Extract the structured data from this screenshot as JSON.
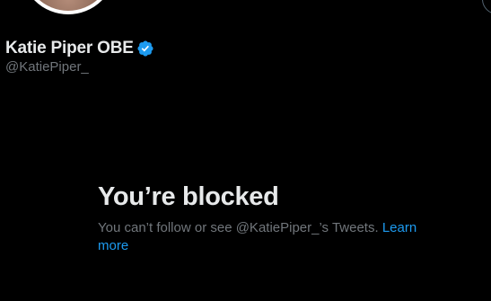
{
  "profile": {
    "name": "Katie Piper OBE",
    "handle": "@KatiePiper_",
    "verified": true,
    "verified_icon": "verified-badge-icon",
    "verified_color": "#1d9bf0"
  },
  "blocked": {
    "title": "You’re blocked",
    "message": "You can’t follow or see @KatiePiper_’s Tweets.",
    "learn_more": "Learn more"
  },
  "colors": {
    "background": "#000000",
    "primary_text": "#e7e9ea",
    "secondary_text": "#71767b",
    "link": "#1d9bf0"
  }
}
